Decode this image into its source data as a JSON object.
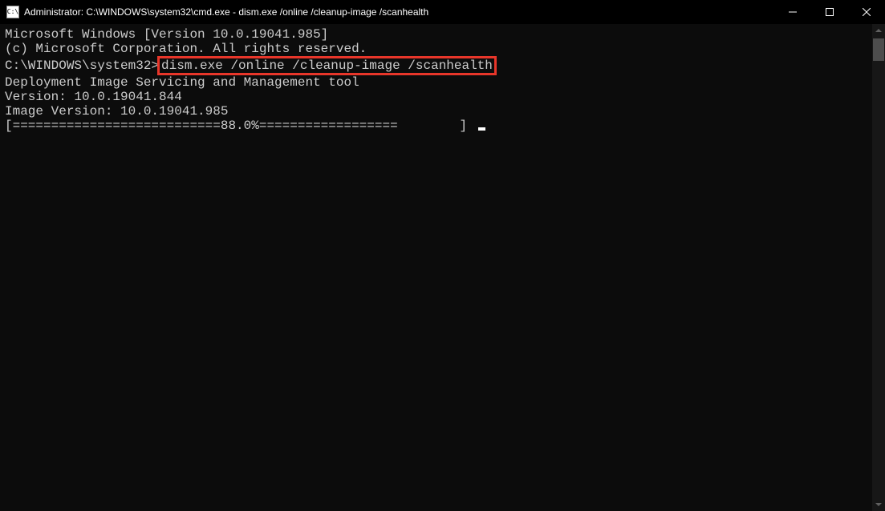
{
  "titlebar": {
    "icon_label": "C:\\",
    "text": "Administrator: C:\\WINDOWS\\system32\\cmd.exe - dism.exe  /online /cleanup-image /scanhealth"
  },
  "terminal": {
    "line1": "Microsoft Windows [Version 10.0.19041.985]",
    "line2": "(c) Microsoft Corporation. All rights reserved.",
    "blank1": "",
    "prompt_prefix": "C:\\WINDOWS\\system32>",
    "command": "dism.exe /online /cleanup-image /scanhealth",
    "blank2": "",
    "line5": "Deployment Image Servicing and Management tool",
    "line6": "Version: 10.0.19041.844",
    "blank3": "",
    "line8": "Image Version: 10.0.19041.985",
    "blank4": "",
    "progress": "[===========================88.0%==================        ] "
  }
}
